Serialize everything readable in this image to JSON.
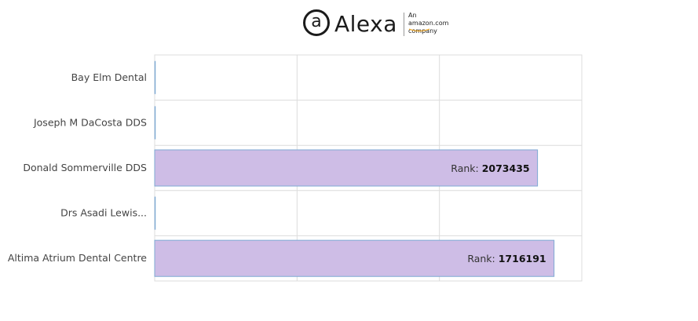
{
  "brand": {
    "logo_symbol": "a",
    "logo_text": "Alexa",
    "tagline_line1": "An",
    "tagline_line2": "amazon.com",
    "tagline_line3": "company"
  },
  "chart_data": {
    "type": "bar",
    "orientation": "horizontal",
    "categories": [
      "Bay Elm Dental",
      "Joseph M DaCosta DDS",
      "Donald Sommerville DDS",
      "Drs Asadi Lewis...",
      "Altima Atrium Dental Centre"
    ],
    "series": [
      {
        "values": [
          null,
          null,
          2073435,
          null,
          1716191
        ]
      }
    ],
    "value_label_prefix": "Rank: ",
    "bar_color": "#cebde6",
    "bar_border_color": "#7ea9d3",
    "grid": true,
    "xlim_note": "bar length not proportional to rank value"
  }
}
